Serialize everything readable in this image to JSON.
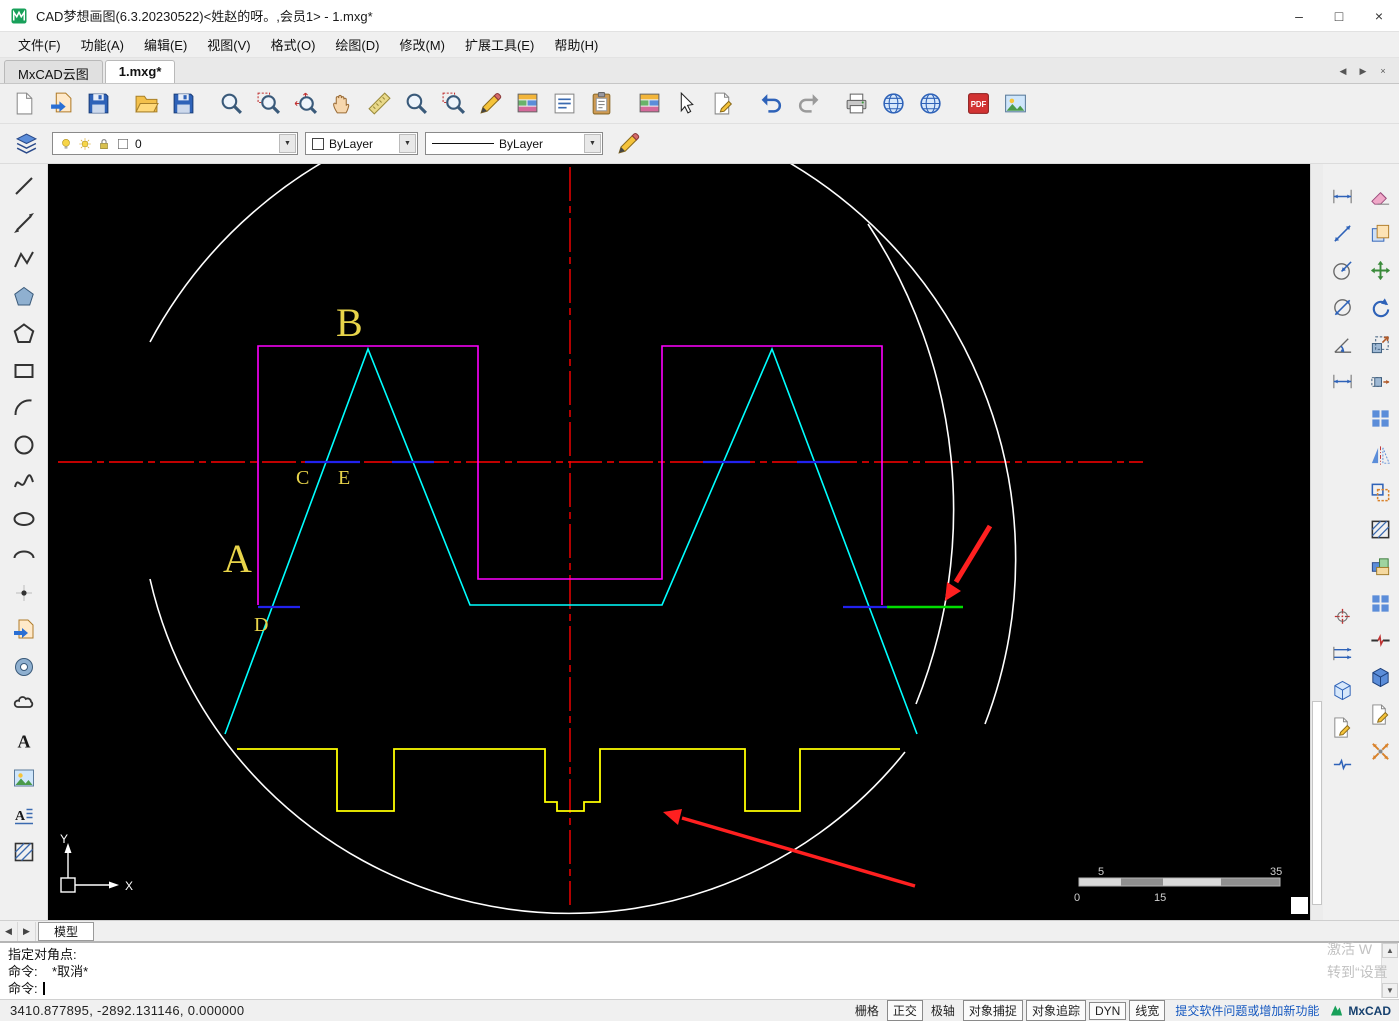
{
  "titlebar": {
    "title": "CAD梦想画图(6.3.20230522)<姓赵的呀。,会员1> - 1.mxg*",
    "minimize": "–",
    "maximize": "□",
    "close": "×"
  },
  "menubar": {
    "items": [
      {
        "name": "file",
        "label": "文件(F)"
      },
      {
        "name": "function",
        "label": "功能(A)"
      },
      {
        "name": "edit",
        "label": "编辑(E)"
      },
      {
        "name": "view",
        "label": "视图(V)"
      },
      {
        "name": "format",
        "label": "格式(O)"
      },
      {
        "name": "draw",
        "label": "绘图(D)"
      },
      {
        "name": "modify",
        "label": "修改(M)"
      },
      {
        "name": "extended-tools",
        "label": "扩展工具(E)"
      },
      {
        "name": "help",
        "label": "帮助(H)"
      }
    ]
  },
  "tabbar": {
    "tabs": [
      {
        "name": "mxcad-cloud",
        "label": "MxCAD云图",
        "active": false
      },
      {
        "name": "drawing-1",
        "label": "1.mxg*",
        "active": true
      }
    ],
    "controls": {
      "prev": "◀",
      "next": "▶",
      "close": "×"
    }
  },
  "toolbar_main": {
    "icons": [
      {
        "name": "new-file",
        "sym": "doc"
      },
      {
        "name": "open-drawing",
        "sym": "docimp"
      },
      {
        "name": "save",
        "sym": "save"
      },
      {
        "name": "open-folder",
        "sym": "folder",
        "sep": true
      },
      {
        "name": "save-as",
        "sym": "save"
      },
      {
        "name": "zoom-previous",
        "sym": "mag",
        "sep": true
      },
      {
        "name": "zoom-window",
        "sym": "magbox"
      },
      {
        "name": "zoom-extents",
        "sym": "magext"
      },
      {
        "name": "pan",
        "sym": "hand"
      },
      {
        "name": "measure-scale",
        "sym": "ruler"
      },
      {
        "name": "zoom-dynamic",
        "sym": "mag"
      },
      {
        "name": "find",
        "sym": "magbox"
      },
      {
        "name": "sketch",
        "sym": "pencil"
      },
      {
        "name": "table-style",
        "sym": "gridc"
      },
      {
        "name": "text-style",
        "sym": "list"
      },
      {
        "name": "paste-clipboard",
        "sym": "clip"
      },
      {
        "name": "layer-manager",
        "sym": "gridc",
        "sep": true
      },
      {
        "name": "quick-select",
        "sym": "cursor"
      },
      {
        "name": "edit-attributes",
        "sym": "docedit"
      },
      {
        "name": "undo",
        "sym": "undo",
        "sep": true
      },
      {
        "name": "redo",
        "sym": "redo"
      },
      {
        "name": "print",
        "sym": "print",
        "sep": true
      },
      {
        "name": "publish-web",
        "sym": "globe"
      },
      {
        "name": "open-website",
        "sym": "globe"
      },
      {
        "name": "export-pdf",
        "sym": "pdf",
        "sep": true
      },
      {
        "name": "export-image",
        "sym": "img"
      }
    ]
  },
  "toolbar_props": {
    "layer": {
      "value": "0"
    },
    "color": {
      "value": "ByLayer"
    },
    "linetype": {
      "value": "ByLayer"
    }
  },
  "draw_toolbar": {
    "icons": [
      {
        "name": "line",
        "sym": "line"
      },
      {
        "name": "construction-line",
        "sym": "xline"
      },
      {
        "name": "polyline",
        "sym": "pline"
      },
      {
        "name": "polygon",
        "sym": "polyf"
      },
      {
        "name": "polygon-outline",
        "sym": "poly"
      },
      {
        "name": "rectangle",
        "sym": "rect"
      },
      {
        "name": "arc",
        "sym": "arc"
      },
      {
        "name": "circle",
        "sym": "circle"
      },
      {
        "name": "spline",
        "sym": "spline"
      },
      {
        "name": "ellipse",
        "sym": "ellipse"
      },
      {
        "name": "ellipse-arc",
        "sym": "ellarc"
      },
      {
        "name": "point",
        "sym": "point"
      },
      {
        "name": "insert-block",
        "sym": "docimp"
      },
      {
        "name": "donut",
        "sym": "donut"
      },
      {
        "name": "revision-cloud",
        "sym": "cloud"
      },
      {
        "name": "text",
        "sym": "textA"
      },
      {
        "name": "image",
        "sym": "img"
      },
      {
        "name": "mtext",
        "sym": "mtext"
      },
      {
        "name": "hatch",
        "sym": "hatch"
      }
    ]
  },
  "dim_toolbar": {
    "icons": [
      {
        "name": "dim-linear",
        "sym": "dimh"
      },
      {
        "name": "dim-aligned",
        "sym": "dima"
      },
      {
        "name": "dim-radius",
        "sym": "dimr"
      },
      {
        "name": "dim-diameter",
        "sym": "dimd"
      },
      {
        "name": "dim-angular",
        "sym": "dimang"
      },
      {
        "name": "dim-rotated",
        "sym": "dimh"
      },
      {
        "name": "dim-center-mark",
        "sym": "dimx",
        "gap": true
      },
      {
        "name": "dim-continue",
        "sym": "dimcont"
      },
      {
        "name": "view-cube",
        "sym": "cube"
      },
      {
        "name": "dim-style",
        "sym": "docedit"
      },
      {
        "name": "dim-break",
        "sym": "dimbrk"
      }
    ]
  },
  "modify_toolbar": {
    "icons": [
      {
        "name": "erase",
        "sym": "erase"
      },
      {
        "name": "copy",
        "sym": "copy"
      },
      {
        "name": "move",
        "sym": "move"
      },
      {
        "name": "rotate",
        "sym": "rotate"
      },
      {
        "name": "scale",
        "sym": "scale"
      },
      {
        "name": "stretch",
        "sym": "stretch"
      },
      {
        "name": "array",
        "sym": "array"
      },
      {
        "name": "mirror",
        "sym": "mirror"
      },
      {
        "name": "offset",
        "sym": "offset"
      },
      {
        "name": "hatch-edit",
        "sym": "hatch"
      },
      {
        "name": "create-block",
        "sym": "blocks"
      },
      {
        "name": "block-library",
        "sym": "array"
      },
      {
        "name": "break",
        "sym": "break"
      },
      {
        "name": "solid-3d",
        "sym": "cube3"
      },
      {
        "name": "edit-polyline",
        "sym": "docedit"
      },
      {
        "name": "explode",
        "sym": "explode"
      }
    ]
  },
  "canvas": {
    "labels": {
      "a": "A",
      "b": "B",
      "c": "C",
      "d": "D",
      "e": "E"
    },
    "ucs": {
      "x": "X",
      "y": "Y"
    },
    "scalebar": {
      "v1": "5",
      "v2": "35",
      "v3": "0",
      "v4": "15"
    },
    "colors": {
      "background": "#000000",
      "centerline": "#ff0000",
      "outline": "#ffffff",
      "tooth_profile": "#ff00ff",
      "tooth_flanks": "#00ffff",
      "bottom_profile": "#ffff00",
      "chords": "#2222ee",
      "highlight": "#00dd00",
      "annotation_arrows": "#ff2020",
      "labels": "#e8d44a"
    }
  },
  "model_bar": {
    "prev": "◀",
    "next": "▶",
    "tab": "模型"
  },
  "command_panel": {
    "lines": [
      "指定对角点:",
      "命令:    *取消*",
      "命令: "
    ],
    "scroll_up": "▲",
    "scroll_down": "▼"
  },
  "statusbar": {
    "coordinates": "3410.877895,  -2892.131146,  0.000000",
    "toggles": [
      {
        "name": "grid",
        "label": "栅格",
        "pressed": false
      },
      {
        "name": "ortho",
        "label": "正交",
        "pressed": true
      },
      {
        "name": "polar",
        "label": "极轴",
        "pressed": false
      },
      {
        "name": "osnap",
        "label": "对象捕捉",
        "pressed": true
      },
      {
        "name": "otrack",
        "label": "对象追踪",
        "pressed": true
      },
      {
        "name": "dyn",
        "label": "DYN",
        "pressed": true
      },
      {
        "name": "lineweight",
        "label": "线宽",
        "pressed": true
      }
    ],
    "link": "提交软件问题或增加新功能",
    "brand": "MxCAD"
  },
  "watermark": {
    "line1": "激活 W",
    "line2": "转到“设置"
  }
}
